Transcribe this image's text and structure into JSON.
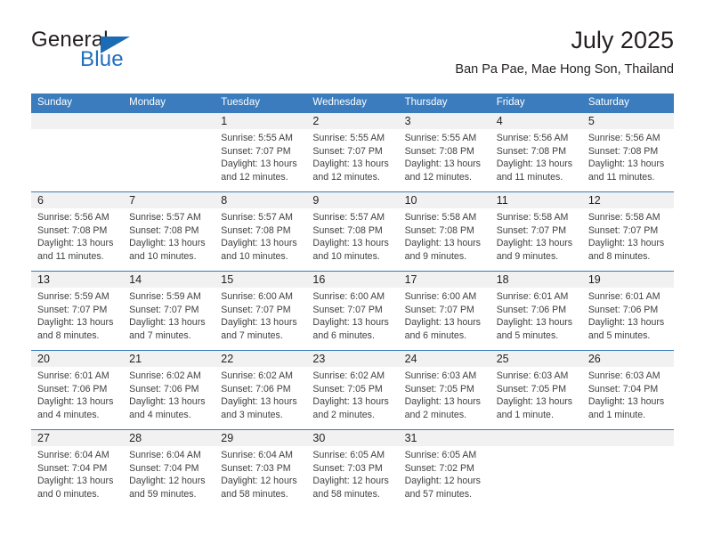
{
  "brand": {
    "name_top": "General",
    "name_bottom": "Blue",
    "accent_color": "#1b6cb5"
  },
  "header": {
    "title": "July 2025",
    "subtitle": "Ban Pa Pae, Mae Hong Son, Thailand"
  },
  "theme": {
    "header_bar_color": "#3a7cbe",
    "daynum_band_color": "#f1f1f1",
    "text_color": "#231f20"
  },
  "weekdays": [
    "Sunday",
    "Monday",
    "Tuesday",
    "Wednesday",
    "Thursday",
    "Friday",
    "Saturday"
  ],
  "weeks": [
    [
      {
        "day": "",
        "sunrise": "",
        "sunset": "",
        "daylight_line1": "",
        "daylight_line2": ""
      },
      {
        "day": "",
        "sunrise": "",
        "sunset": "",
        "daylight_line1": "",
        "daylight_line2": ""
      },
      {
        "day": "1",
        "sunrise": "Sunrise: 5:55 AM",
        "sunset": "Sunset: 7:07 PM",
        "daylight_line1": "Daylight: 13 hours",
        "daylight_line2": "and 12 minutes."
      },
      {
        "day": "2",
        "sunrise": "Sunrise: 5:55 AM",
        "sunset": "Sunset: 7:07 PM",
        "daylight_line1": "Daylight: 13 hours",
        "daylight_line2": "and 12 minutes."
      },
      {
        "day": "3",
        "sunrise": "Sunrise: 5:55 AM",
        "sunset": "Sunset: 7:08 PM",
        "daylight_line1": "Daylight: 13 hours",
        "daylight_line2": "and 12 minutes."
      },
      {
        "day": "4",
        "sunrise": "Sunrise: 5:56 AM",
        "sunset": "Sunset: 7:08 PM",
        "daylight_line1": "Daylight: 13 hours",
        "daylight_line2": "and 11 minutes."
      },
      {
        "day": "5",
        "sunrise": "Sunrise: 5:56 AM",
        "sunset": "Sunset: 7:08 PM",
        "daylight_line1": "Daylight: 13 hours",
        "daylight_line2": "and 11 minutes."
      }
    ],
    [
      {
        "day": "6",
        "sunrise": "Sunrise: 5:56 AM",
        "sunset": "Sunset: 7:08 PM",
        "daylight_line1": "Daylight: 13 hours",
        "daylight_line2": "and 11 minutes."
      },
      {
        "day": "7",
        "sunrise": "Sunrise: 5:57 AM",
        "sunset": "Sunset: 7:08 PM",
        "daylight_line1": "Daylight: 13 hours",
        "daylight_line2": "and 10 minutes."
      },
      {
        "day": "8",
        "sunrise": "Sunrise: 5:57 AM",
        "sunset": "Sunset: 7:08 PM",
        "daylight_line1": "Daylight: 13 hours",
        "daylight_line2": "and 10 minutes."
      },
      {
        "day": "9",
        "sunrise": "Sunrise: 5:57 AM",
        "sunset": "Sunset: 7:08 PM",
        "daylight_line1": "Daylight: 13 hours",
        "daylight_line2": "and 10 minutes."
      },
      {
        "day": "10",
        "sunrise": "Sunrise: 5:58 AM",
        "sunset": "Sunset: 7:08 PM",
        "daylight_line1": "Daylight: 13 hours",
        "daylight_line2": "and 9 minutes."
      },
      {
        "day": "11",
        "sunrise": "Sunrise: 5:58 AM",
        "sunset": "Sunset: 7:07 PM",
        "daylight_line1": "Daylight: 13 hours",
        "daylight_line2": "and 9 minutes."
      },
      {
        "day": "12",
        "sunrise": "Sunrise: 5:58 AM",
        "sunset": "Sunset: 7:07 PM",
        "daylight_line1": "Daylight: 13 hours",
        "daylight_line2": "and 8 minutes."
      }
    ],
    [
      {
        "day": "13",
        "sunrise": "Sunrise: 5:59 AM",
        "sunset": "Sunset: 7:07 PM",
        "daylight_line1": "Daylight: 13 hours",
        "daylight_line2": "and 8 minutes."
      },
      {
        "day": "14",
        "sunrise": "Sunrise: 5:59 AM",
        "sunset": "Sunset: 7:07 PM",
        "daylight_line1": "Daylight: 13 hours",
        "daylight_line2": "and 7 minutes."
      },
      {
        "day": "15",
        "sunrise": "Sunrise: 6:00 AM",
        "sunset": "Sunset: 7:07 PM",
        "daylight_line1": "Daylight: 13 hours",
        "daylight_line2": "and 7 minutes."
      },
      {
        "day": "16",
        "sunrise": "Sunrise: 6:00 AM",
        "sunset": "Sunset: 7:07 PM",
        "daylight_line1": "Daylight: 13 hours",
        "daylight_line2": "and 6 minutes."
      },
      {
        "day": "17",
        "sunrise": "Sunrise: 6:00 AM",
        "sunset": "Sunset: 7:07 PM",
        "daylight_line1": "Daylight: 13 hours",
        "daylight_line2": "and 6 minutes."
      },
      {
        "day": "18",
        "sunrise": "Sunrise: 6:01 AM",
        "sunset": "Sunset: 7:06 PM",
        "daylight_line1": "Daylight: 13 hours",
        "daylight_line2": "and 5 minutes."
      },
      {
        "day": "19",
        "sunrise": "Sunrise: 6:01 AM",
        "sunset": "Sunset: 7:06 PM",
        "daylight_line1": "Daylight: 13 hours",
        "daylight_line2": "and 5 minutes."
      }
    ],
    [
      {
        "day": "20",
        "sunrise": "Sunrise: 6:01 AM",
        "sunset": "Sunset: 7:06 PM",
        "daylight_line1": "Daylight: 13 hours",
        "daylight_line2": "and 4 minutes."
      },
      {
        "day": "21",
        "sunrise": "Sunrise: 6:02 AM",
        "sunset": "Sunset: 7:06 PM",
        "daylight_line1": "Daylight: 13 hours",
        "daylight_line2": "and 4 minutes."
      },
      {
        "day": "22",
        "sunrise": "Sunrise: 6:02 AM",
        "sunset": "Sunset: 7:06 PM",
        "daylight_line1": "Daylight: 13 hours",
        "daylight_line2": "and 3 minutes."
      },
      {
        "day": "23",
        "sunrise": "Sunrise: 6:02 AM",
        "sunset": "Sunset: 7:05 PM",
        "daylight_line1": "Daylight: 13 hours",
        "daylight_line2": "and 2 minutes."
      },
      {
        "day": "24",
        "sunrise": "Sunrise: 6:03 AM",
        "sunset": "Sunset: 7:05 PM",
        "daylight_line1": "Daylight: 13 hours",
        "daylight_line2": "and 2 minutes."
      },
      {
        "day": "25",
        "sunrise": "Sunrise: 6:03 AM",
        "sunset": "Sunset: 7:05 PM",
        "daylight_line1": "Daylight: 13 hours",
        "daylight_line2": "and 1 minute."
      },
      {
        "day": "26",
        "sunrise": "Sunrise: 6:03 AM",
        "sunset": "Sunset: 7:04 PM",
        "daylight_line1": "Daylight: 13 hours",
        "daylight_line2": "and 1 minute."
      }
    ],
    [
      {
        "day": "27",
        "sunrise": "Sunrise: 6:04 AM",
        "sunset": "Sunset: 7:04 PM",
        "daylight_line1": "Daylight: 13 hours",
        "daylight_line2": "and 0 minutes."
      },
      {
        "day": "28",
        "sunrise": "Sunrise: 6:04 AM",
        "sunset": "Sunset: 7:04 PM",
        "daylight_line1": "Daylight: 12 hours",
        "daylight_line2": "and 59 minutes."
      },
      {
        "day": "29",
        "sunrise": "Sunrise: 6:04 AM",
        "sunset": "Sunset: 7:03 PM",
        "daylight_line1": "Daylight: 12 hours",
        "daylight_line2": "and 58 minutes."
      },
      {
        "day": "30",
        "sunrise": "Sunrise: 6:05 AM",
        "sunset": "Sunset: 7:03 PM",
        "daylight_line1": "Daylight: 12 hours",
        "daylight_line2": "and 58 minutes."
      },
      {
        "day": "31",
        "sunrise": "Sunrise: 6:05 AM",
        "sunset": "Sunset: 7:02 PM",
        "daylight_line1": "Daylight: 12 hours",
        "daylight_line2": "and 57 minutes."
      },
      {
        "day": "",
        "sunrise": "",
        "sunset": "",
        "daylight_line1": "",
        "daylight_line2": ""
      },
      {
        "day": "",
        "sunrise": "",
        "sunset": "",
        "daylight_line1": "",
        "daylight_line2": ""
      }
    ]
  ]
}
